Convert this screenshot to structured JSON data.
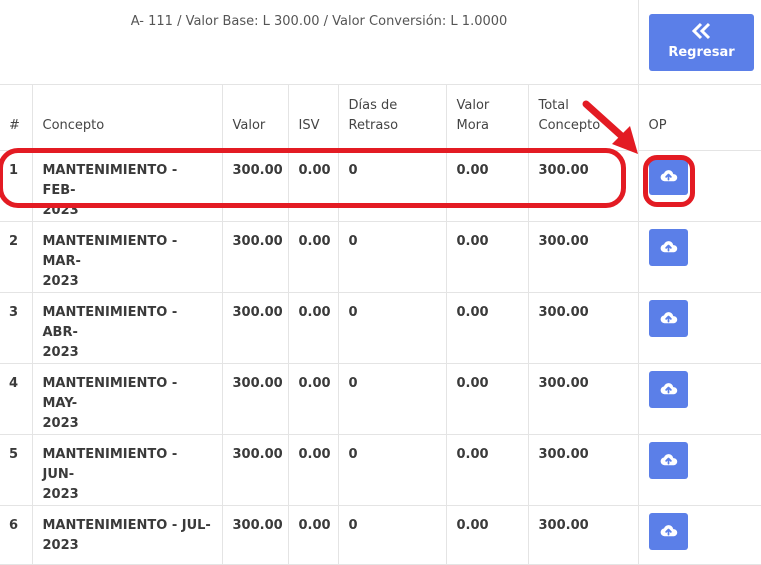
{
  "header": {
    "info": "A- 111 / Valor Base: L 300.00 / Valor Conversión: L 1.0000",
    "back_button": "Regresar",
    "back_icon": "chevrons-left-icon"
  },
  "columns": {
    "num": "#",
    "concepto": "Concepto",
    "valor": "Valor",
    "isv": "ISV",
    "dias_line1": "Días de",
    "dias_line2": "Retraso",
    "mora_line1": "Valor",
    "mora_line2": "Mora",
    "total_line1": "Total",
    "total_line2": "Concepto",
    "op": "OP"
  },
  "rows": [
    {
      "num": "1",
      "concepto_1": "MANTENIMIENTO - FEB-",
      "concepto_2": "2023",
      "valor": "300.00",
      "isv": "0.00",
      "dias": "0",
      "mora": "0.00",
      "total": "300.00"
    },
    {
      "num": "2",
      "concepto_1": "MANTENIMIENTO - MAR-",
      "concepto_2": "2023",
      "valor": "300.00",
      "isv": "0.00",
      "dias": "0",
      "mora": "0.00",
      "total": "300.00"
    },
    {
      "num": "3",
      "concepto_1": "MANTENIMIENTO - ABR-",
      "concepto_2": "2023",
      "valor": "300.00",
      "isv": "0.00",
      "dias": "0",
      "mora": "0.00",
      "total": "300.00"
    },
    {
      "num": "4",
      "concepto_1": "MANTENIMIENTO - MAY-",
      "concepto_2": "2023",
      "valor": "300.00",
      "isv": "0.00",
      "dias": "0",
      "mora": "0.00",
      "total": "300.00"
    },
    {
      "num": "5",
      "concepto_1": "MANTENIMIENTO - JUN-",
      "concepto_2": "2023",
      "valor": "300.00",
      "isv": "0.00",
      "dias": "0",
      "mora": "0.00",
      "total": "300.00"
    },
    {
      "num": "6",
      "concepto_1": "MANTENIMIENTO - JUL-",
      "concepto_2": "2023",
      "valor": "300.00",
      "isv": "0.00",
      "dias": "0",
      "mora": "0.00",
      "total": "300.00"
    }
  ],
  "op_icon": "cloud-upload-icon",
  "colors": {
    "accent": "#5b7fe8",
    "highlight": "#e31b23"
  }
}
